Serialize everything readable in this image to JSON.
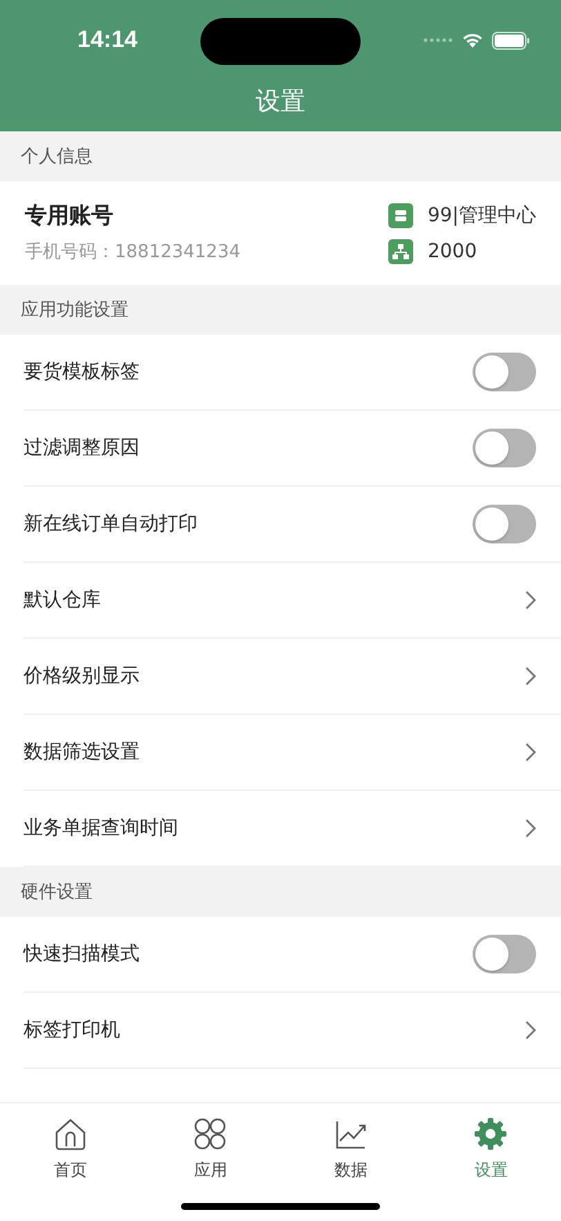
{
  "status_bar": {
    "time": "14:14"
  },
  "header": {
    "title": "设置"
  },
  "sections": [
    {
      "title": "个人信息",
      "kind": "profile",
      "profile": {
        "name": "专用账号",
        "phone": "手机号码：18812341234",
        "store": "99|管理中心",
        "code": "2000"
      }
    },
    {
      "title": "应用功能设置",
      "kind": "list",
      "rows": [
        {
          "label": "要货模板标签",
          "kind": "toggle",
          "on": false
        },
        {
          "label": "过滤调整原因",
          "kind": "toggle",
          "on": false
        },
        {
          "label": "新在线订单自动打印",
          "kind": "toggle",
          "on": false
        },
        {
          "label": "默认仓库",
          "kind": "link"
        },
        {
          "label": "价格级别显示",
          "kind": "link"
        },
        {
          "label": "数据筛选设置",
          "kind": "link"
        },
        {
          "label": "业务单据查询时间",
          "kind": "link"
        }
      ]
    },
    {
      "title": "硬件设置",
      "kind": "list",
      "rows": [
        {
          "label": "快速扫描模式",
          "kind": "toggle",
          "on": false
        },
        {
          "label": "标签打印机",
          "kind": "link"
        }
      ]
    }
  ],
  "tab_bar": [
    {
      "label": "首页",
      "kind": "home",
      "selected": false
    },
    {
      "label": "应用",
      "kind": "apps",
      "selected": false
    },
    {
      "label": "数据",
      "kind": "chart",
      "selected": false
    },
    {
      "label": "设置",
      "kind": "gear",
      "selected": true
    }
  ]
}
